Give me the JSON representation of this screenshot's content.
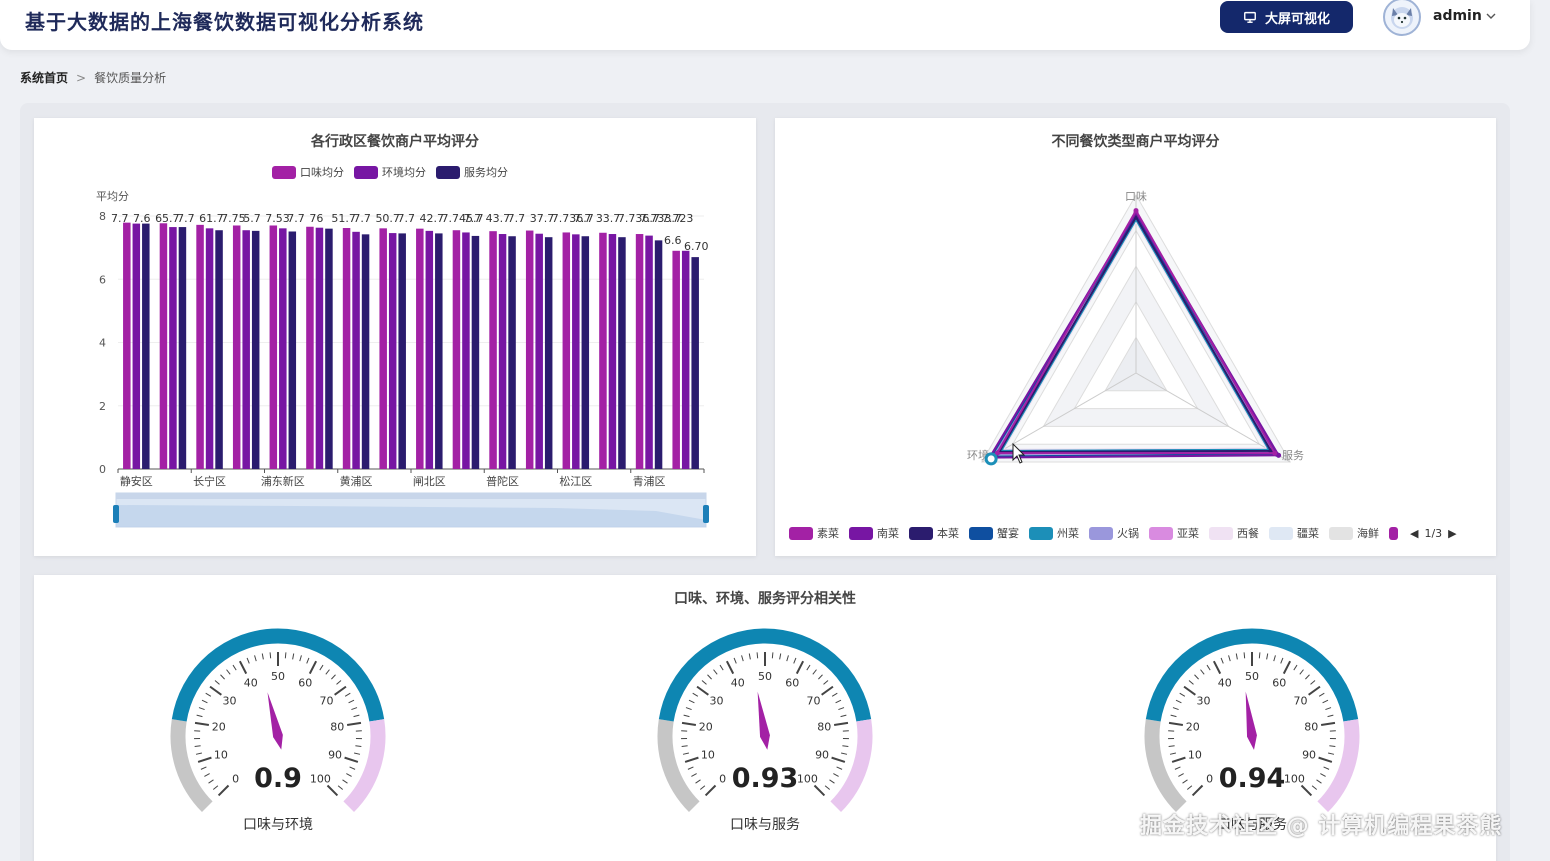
{
  "app": {
    "title": "基于大数据的上海餐饮数据可视化分析系统",
    "screen_button_label": "大屏可视化",
    "username": "admin"
  },
  "breadcrumb": {
    "home": "系统首页",
    "separator": ">",
    "current": "餐饮质量分析"
  },
  "district_chart": {
    "title": "各行政区餐饮商户平均评分",
    "legend": [
      "口味均分",
      "环境均分",
      "服务均分"
    ],
    "colors": [
      "#a321a5",
      "#7716a3",
      "#2b1c6e"
    ]
  },
  "radar_chart": {
    "title": "不同餐饮类型商户平均评分",
    "indicators": [
      "口味",
      "服务",
      "环境"
    ],
    "legend": [
      {
        "name": "素菜",
        "color": "#a321a5"
      },
      {
        "name": "南菜",
        "color": "#7716a3"
      },
      {
        "name": "本菜",
        "color": "#2b1c6e"
      },
      {
        "name": "蟹宴",
        "color": "#0f4fa0"
      },
      {
        "name": "州菜",
        "color": "#1c8fb8"
      },
      {
        "name": "火锅",
        "color": "#9a97dc"
      },
      {
        "name": "亚菜",
        "color": "#d98be0"
      },
      {
        "name": "西餐",
        "color": "#f0e2f3"
      },
      {
        "name": "疆菜",
        "color": "#dfe8f4"
      },
      {
        "name": "海鲜",
        "color": "#e3e3e3"
      }
    ],
    "page_indicator": "1/3"
  },
  "correlation": {
    "title": "口味、环境、服务评分相关性",
    "gauges": [
      {
        "label": "口味与环境",
        "display": "0.9",
        "value": 0.9
      },
      {
        "label": "口味与服务",
        "display": "0.93",
        "value": 0.93
      },
      {
        "label": "口味与服务",
        "display": "0.94",
        "value": 0.94
      }
    ],
    "tick_labels": [
      "0",
      "10",
      "20",
      "30",
      "40",
      "50",
      "60",
      "70",
      "80",
      "90",
      "100"
    ]
  },
  "watermark": "掘金技术社区 @ 计算机编程果茶熊",
  "chart_data": [
    {
      "type": "bar",
      "title": "各行政区餐饮商户平均评分",
      "ylabel": "平均分",
      "ylim": [
        0,
        8
      ],
      "yticks": [
        "0",
        "2",
        "4",
        "6",
        "8"
      ],
      "categories": [
        "静安区",
        "",
        "长宁区",
        "",
        "浦东新区",
        "",
        "黄浦区",
        "",
        "闸北区",
        "",
        "普陀区",
        "",
        "松江区",
        "",
        "青浦区",
        ""
      ],
      "xtick_labels": [
        "静安区",
        "长宁区",
        "浦东新区",
        "黄浦区",
        "闸北区",
        "普陀区",
        "松江区",
        "青浦区"
      ],
      "series": [
        {
          "name": "口味均分",
          "values": [
            7.79,
            7.77,
            7.72,
            7.7,
            7.7,
            7.66,
            7.62,
            7.61,
            7.6,
            7.55,
            7.52,
            7.54,
            7.48,
            7.47,
            7.43,
            6.9
          ]
        },
        {
          "name": "环境均分",
          "values": [
            7.76,
            7.65,
            7.61,
            7.55,
            7.61,
            7.63,
            7.5,
            7.46,
            7.53,
            7.48,
            7.43,
            7.44,
            7.42,
            7.43,
            7.38,
            6.9
          ]
        },
        {
          "name": "服务均分",
          "values": [
            7.76,
            7.65,
            7.55,
            7.53,
            7.51,
            7.6,
            7.42,
            7.45,
            7.45,
            7.37,
            7.36,
            7.33,
            7.36,
            7.33,
            7.23,
            6.7
          ]
        }
      ],
      "data_labels": [
        "7.7",
        "7.6",
        "65.7",
        "7.7",
        "61.7",
        "7.75",
        "5.7",
        "7.53",
        "7.7",
        "76",
        "51.7",
        "7.7",
        "50.7",
        "7.7",
        "42.7",
        "7.745.7",
        "7.7",
        "43.7",
        "7.7",
        "37.7",
        "7.736.7",
        "7.7",
        "33.7",
        "7.736.7",
        "7.733.7",
        "7.723",
        "6.6",
        "6.70"
      ],
      "datazoom": {
        "start": 0,
        "end": 100
      }
    },
    {
      "type": "radar",
      "title": "不同餐饮类型商户平均评分",
      "indicators": [
        "口味",
        "服务",
        "环境"
      ],
      "max": 8,
      "series": [
        {
          "name": "素菜",
          "values": [
            7.3,
            7.2,
            7.2
          ]
        },
        {
          "name": "南菜",
          "values": [
            7.2,
            7.4,
            7.6
          ]
        },
        {
          "name": "本菜",
          "values": [
            7.0,
            7.0,
            7.1
          ]
        },
        {
          "name": "蟹宴",
          "values": [
            7.1,
            7.3,
            7.5
          ]
        },
        {
          "name": "州菜",
          "values": [
            6.9,
            6.9,
            7.0
          ]
        },
        {
          "name": "火锅",
          "values": [
            7.2,
            7.1,
            7.3
          ]
        },
        {
          "name": "亚菜",
          "values": [
            7.0,
            6.9,
            7.0
          ]
        },
        {
          "name": "西餐",
          "values": [
            6.8,
            6.8,
            6.9
          ]
        },
        {
          "name": "疆菜",
          "values": [
            6.9,
            6.8,
            6.9
          ]
        },
        {
          "name": "海鲜",
          "values": [
            7.0,
            6.9,
            7.0
          ]
        }
      ]
    }
  ]
}
